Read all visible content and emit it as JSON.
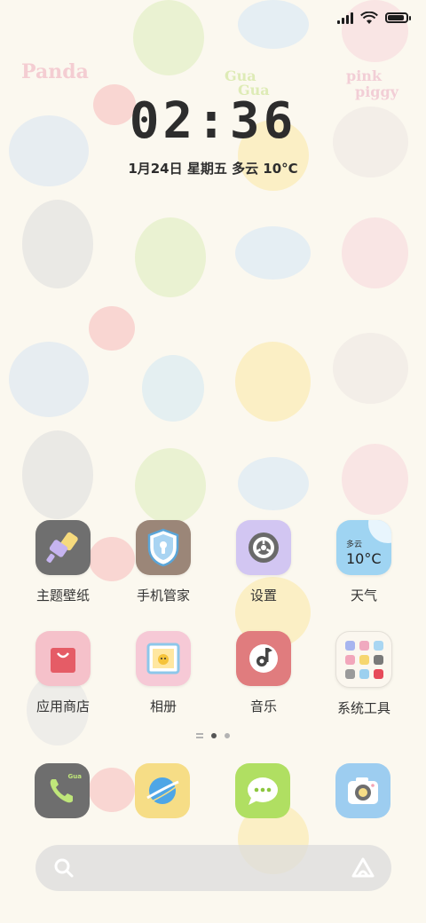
{
  "status_bar": {
    "battery_level": 0.9,
    "icons": [
      "signal-icon",
      "wifi-icon",
      "battery-icon"
    ]
  },
  "clock": {
    "time": "02:36"
  },
  "date_line": {
    "text": "1月24日  星期五  多云  10°C"
  },
  "wallpaper": {
    "texts": [
      "Panda",
      "Gua",
      "Gua",
      "pink",
      "piggy"
    ]
  },
  "apps": {
    "theme": {
      "label": "主题壁纸",
      "icon": "paintbrush-icon",
      "color": "#6f6f6f"
    },
    "security": {
      "label": "手机管家",
      "icon": "shield-lock-icon",
      "color": "#9b8678"
    },
    "settings": {
      "label": "设置",
      "icon": "gear-icon",
      "color": "#d2c6f2"
    },
    "weather": {
      "label": "天气",
      "icon": "weather-widget-icon",
      "color": "#9fd4f2",
      "condition": "多云",
      "temp": "10°C"
    },
    "store": {
      "label": "应用商店",
      "icon": "shopping-bag-icon",
      "color": "#f5c1ca"
    },
    "gallery": {
      "label": "相册",
      "icon": "photo-icon",
      "color": "#f6c9d6"
    },
    "music": {
      "label": "音乐",
      "icon": "music-note-icon",
      "color": "#e07c7e"
    },
    "tools": {
      "label": "系统工具",
      "icon": "folder-icon",
      "color": "#fbf7ef"
    }
  },
  "dock": [
    {
      "name": "phone",
      "icon": "phone-icon",
      "color": "#6e6e6e",
      "badge": "Gua"
    },
    {
      "name": "browser",
      "icon": "planet-icon",
      "color": "#f6dd86"
    },
    {
      "name": "messages",
      "icon": "chat-bubble-icon",
      "color": "#b0df62"
    },
    {
      "name": "camera",
      "icon": "camera-icon",
      "color": "#9dcdf0"
    }
  ],
  "page_indicator": {
    "pages": 2,
    "current": 1
  }
}
